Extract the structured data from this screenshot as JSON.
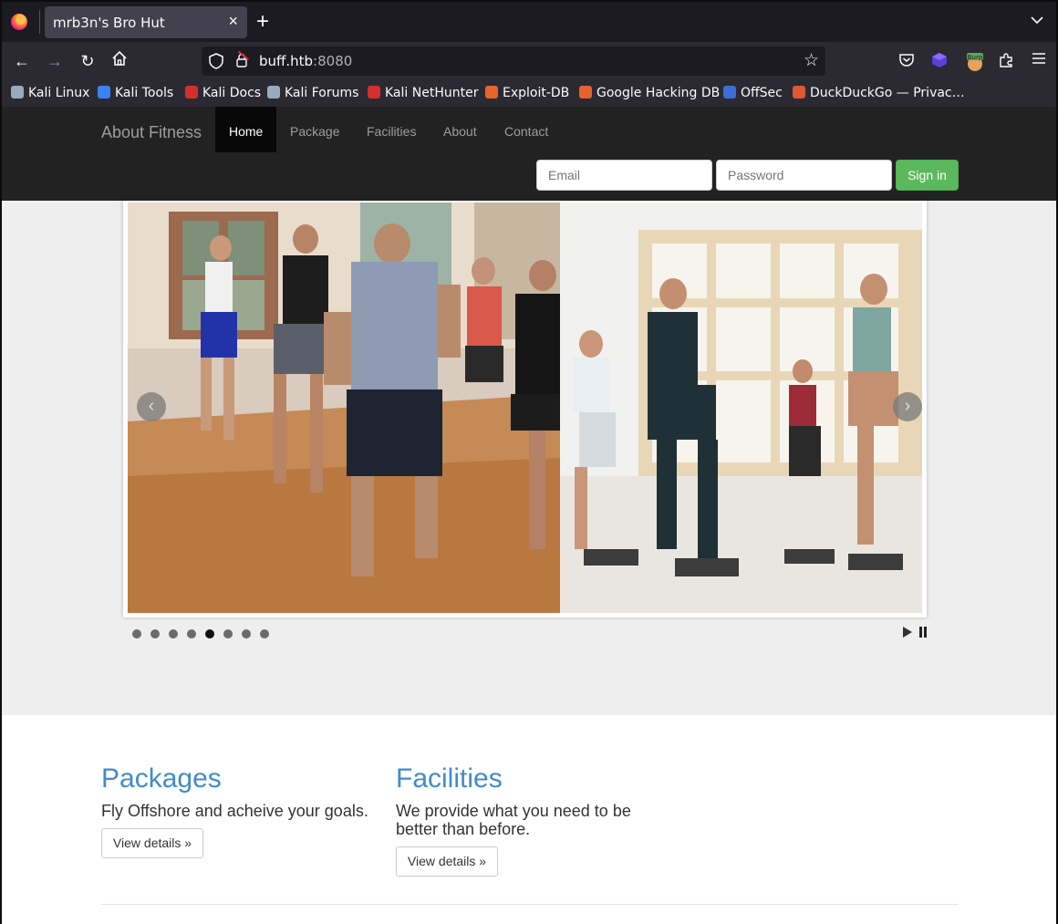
{
  "browser": {
    "tab_title": "mrb3n's Bro Hut",
    "url_host": "buff.htb",
    "url_port": ":8080",
    "bookmarks": [
      {
        "label": "Kali Linux",
        "color": "#9ab"
      },
      {
        "label": "Kali Tools",
        "color": "#3b82f6"
      },
      {
        "label": "Kali Docs",
        "color": "#d32f2f"
      },
      {
        "label": "Kali Forums",
        "color": "#9ab"
      },
      {
        "label": "Kali NetHunter",
        "color": "#d32f2f"
      },
      {
        "label": "Exploit-DB",
        "color": "#e8622c"
      },
      {
        "label": "Google Hacking DB",
        "color": "#e8622c"
      },
      {
        "label": "OffSec",
        "color": "#3b6fd6"
      },
      {
        "label": "DuckDuckGo — Privac…",
        "color": "#de5833"
      }
    ],
    "ext_badge": "Burp"
  },
  "site": {
    "brand": "About Fitness",
    "nav": [
      "Home",
      "Package",
      "Facilities",
      "About",
      "Contact"
    ],
    "active_nav": "Home",
    "email_placeholder": "Email",
    "password_placeholder": "Password",
    "signin_label": "Sign in"
  },
  "carousel": {
    "prev": "‹",
    "next": "›",
    "slide_count": 8,
    "active_slide": 5
  },
  "columns": [
    {
      "heading": "Packages",
      "text": "Fly Offshore and acheive your goals.",
      "button": "View details »"
    },
    {
      "heading": "Facilities",
      "text": "We provide what you need to be better than before.",
      "button": "View details »"
    }
  ]
}
